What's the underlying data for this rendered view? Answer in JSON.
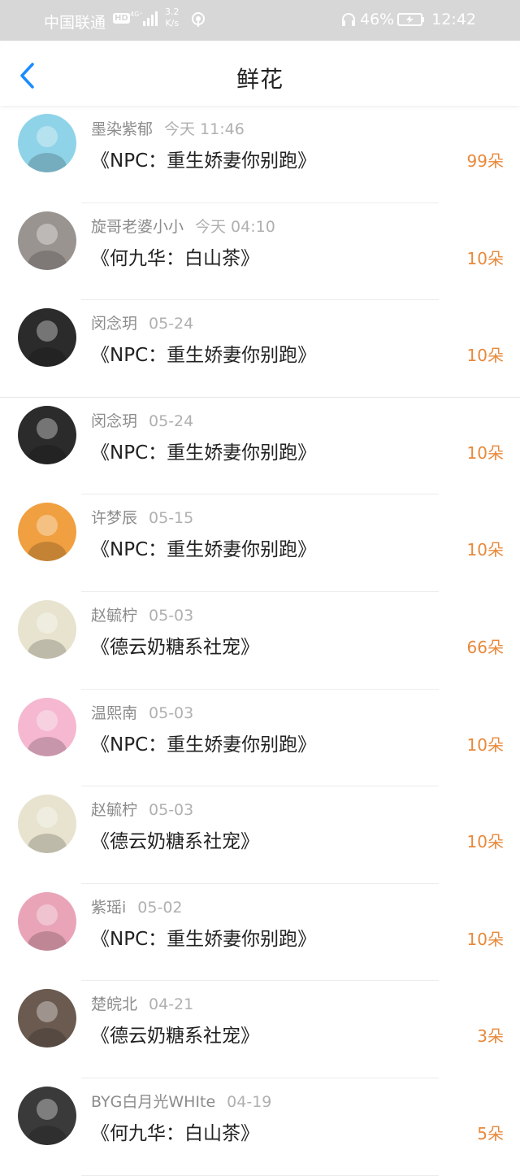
{
  "status_bar": {
    "carrier": "中国联通",
    "hd": "HD",
    "speed_value": "3.2",
    "speed_unit": "K/s",
    "battery": "46%",
    "time": "12:42"
  },
  "header": {
    "title": "鲜花"
  },
  "items": [
    {
      "user": "墨染紫郁",
      "time": "今天 11:46",
      "book": "《NPC：重生娇妻你别跑》",
      "flowers": "99朵",
      "avatar_color": "#8fd3e8"
    },
    {
      "user": "旋哥老婆小小",
      "time": "今天 04:10",
      "book": "《何九华：白山茶》",
      "flowers": "10朵",
      "avatar_color": "#9a9490"
    },
    {
      "user": "闵念玥",
      "time": "05-24",
      "book": "《NPC：重生娇妻你别跑》",
      "flowers": "10朵",
      "avatar_color": "#2b2b2b"
    },
    {
      "user": "闵念玥",
      "time": "05-24",
      "book": "《NPC：重生娇妻你别跑》",
      "flowers": "10朵",
      "avatar_color": "#2b2b2b"
    },
    {
      "user": "许梦辰",
      "time": "05-15",
      "book": "《NPC：重生娇妻你别跑》",
      "flowers": "10朵",
      "avatar_color": "#f0a040"
    },
    {
      "user": "赵毓柠",
      "time": "05-03",
      "book": "《德云奶糖系社宠》",
      "flowers": "66朵",
      "avatar_color": "#e7e3cf"
    },
    {
      "user": "温熙南",
      "time": "05-03",
      "book": "《NPC：重生娇妻你别跑》",
      "flowers": "10朵",
      "avatar_color": "#f5b8d0"
    },
    {
      "user": "赵毓柠",
      "time": "05-03",
      "book": "《德云奶糖系社宠》",
      "flowers": "10朵",
      "avatar_color": "#e7e3cf"
    },
    {
      "user": "紫瑶i",
      "time": "05-02",
      "book": "《NPC：重生娇妻你别跑》",
      "flowers": "10朵",
      "avatar_color": "#e9a4b8"
    },
    {
      "user": "楚皖北",
      "time": "04-21",
      "book": "《德云奶糖系社宠》",
      "flowers": "3朵",
      "avatar_color": "#6a5a50"
    },
    {
      "user": "BYG白月光WHIte",
      "time": "04-19",
      "book": "《何九华：白山茶》",
      "flowers": "5朵",
      "avatar_color": "#3a3a3a"
    }
  ],
  "colors": {
    "accent": "#1a8cff",
    "flowers": "#e8893b"
  }
}
